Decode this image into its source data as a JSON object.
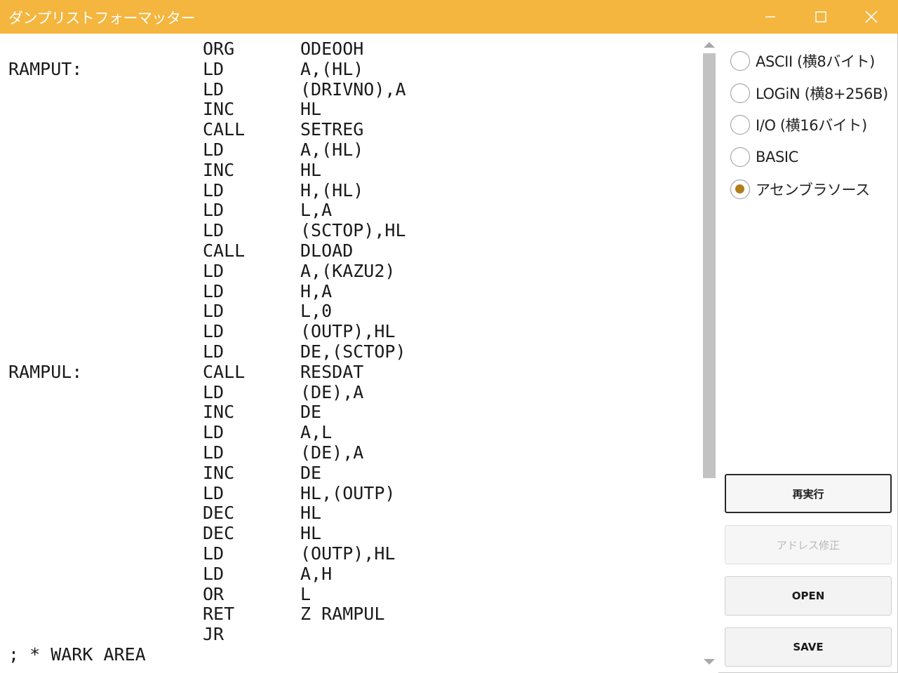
{
  "window": {
    "title": "ダンプリストフォーマッター",
    "accent_color": "#f4b63f",
    "minimize_icon": "minimize-icon",
    "maximize_icon": "maximize-icon",
    "close_icon": "close-icon"
  },
  "code": {
    "lines": [
      {
        "label": "",
        "op": "ORG",
        "arg": "ODEOOH"
      },
      {
        "label": "RAMPUT:",
        "op": "LD",
        "arg": "A,(HL)"
      },
      {
        "label": "",
        "op": "LD",
        "arg": "(DRIVNO),A"
      },
      {
        "label": "",
        "op": "INC",
        "arg": "HL"
      },
      {
        "label": "",
        "op": "CALL",
        "arg": "SETREG"
      },
      {
        "label": "",
        "op": "LD",
        "arg": "A,(HL)"
      },
      {
        "label": "",
        "op": "INC",
        "arg": "HL"
      },
      {
        "label": "",
        "op": "LD",
        "arg": "H,(HL)"
      },
      {
        "label": "",
        "op": "LD",
        "arg": "L,A"
      },
      {
        "label": "",
        "op": "LD",
        "arg": "(SCTOP),HL"
      },
      {
        "label": "",
        "op": "CALL",
        "arg": "DLOAD"
      },
      {
        "label": "",
        "op": "LD",
        "arg": "A,(KAZU2)"
      },
      {
        "label": "",
        "op": "LD",
        "arg": "H,A"
      },
      {
        "label": "",
        "op": "LD",
        "arg": "L,0"
      },
      {
        "label": "",
        "op": "LD",
        "arg": "(OUTP),HL"
      },
      {
        "label": "",
        "op": "LD",
        "arg": "DE,(SCTOP)"
      },
      {
        "label": "RAMPUL:",
        "op": "CALL",
        "arg": "RESDAT"
      },
      {
        "label": "",
        "op": "LD",
        "arg": "(DE),A"
      },
      {
        "label": "",
        "op": "INC",
        "arg": "DE"
      },
      {
        "label": "",
        "op": "LD",
        "arg": "A,L"
      },
      {
        "label": "",
        "op": "LD",
        "arg": "(DE),A"
      },
      {
        "label": "",
        "op": "INC",
        "arg": "DE"
      },
      {
        "label": "",
        "op": "LD",
        "arg": "HL,(OUTP)"
      },
      {
        "label": "",
        "op": "DEC",
        "arg": "HL"
      },
      {
        "label": "",
        "op": "DEC",
        "arg": "HL"
      },
      {
        "label": "",
        "op": "LD",
        "arg": "(OUTP),HL"
      },
      {
        "label": "",
        "op": "LD",
        "arg": "A,H"
      },
      {
        "label": "",
        "op": "OR",
        "arg": "L"
      },
      {
        "label": "",
        "op": "RET",
        "arg": "Z RAMPUL"
      },
      {
        "label": "",
        "op": "JR",
        "arg": ""
      },
      {
        "label": "; * WARK AREA",
        "op": "",
        "arg": ""
      }
    ]
  },
  "scrollbar": {
    "up_icon": "scroll-up-arrow-icon",
    "down_icon": "scroll-down-arrow-icon"
  },
  "format_options": {
    "items": [
      {
        "label": "ASCII (横8バイト)",
        "checked": false
      },
      {
        "label": "LOGiN (横8+256B)",
        "checked": false
      },
      {
        "label": "I/O (横16バイト)",
        "checked": false
      },
      {
        "label": "BASIC",
        "checked": false
      },
      {
        "label": "アセンブラソース",
        "checked": true
      }
    ],
    "selected_color": "#b27d16"
  },
  "buttons": {
    "rerun": "再実行",
    "fix_address": "アドレス修正",
    "open": "OPEN",
    "save": "SAVE"
  }
}
